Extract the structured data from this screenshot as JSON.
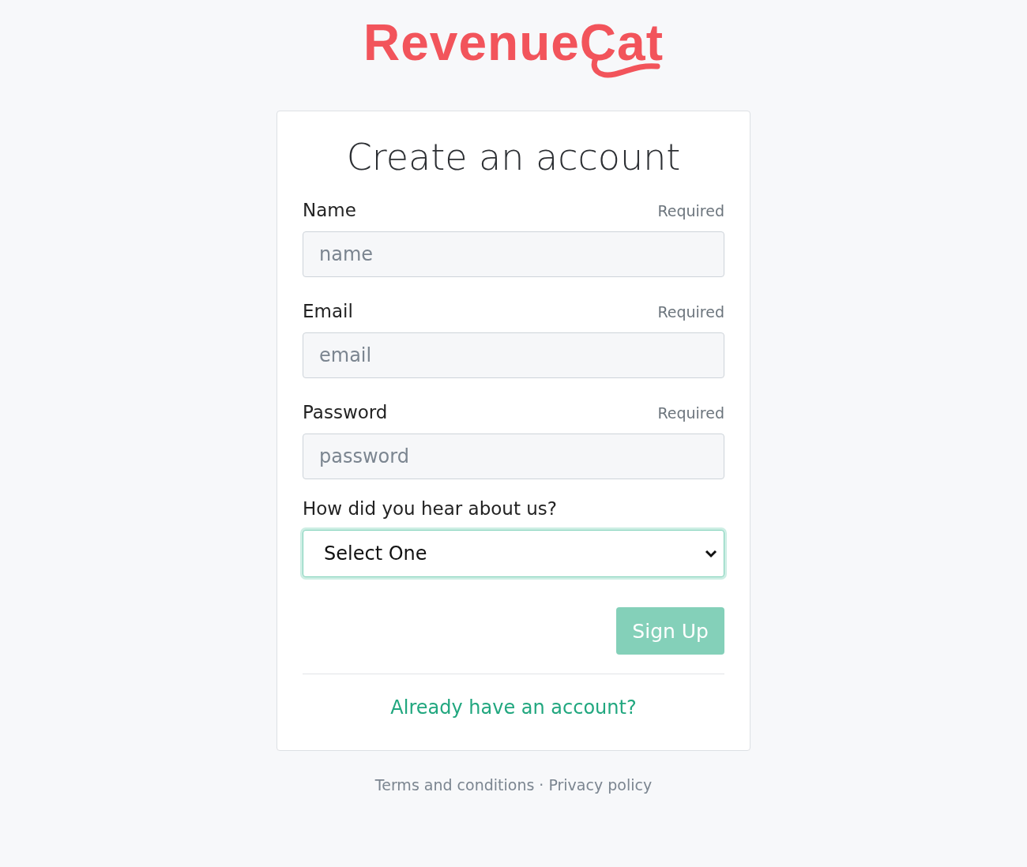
{
  "logo": {
    "text": "RevenueCat"
  },
  "card": {
    "title": "Create an account",
    "fields": [
      {
        "label": "Name",
        "hint": "Required",
        "placeholder": "name"
      },
      {
        "label": "Email",
        "hint": "Required",
        "placeholder": "email"
      },
      {
        "label": "Password",
        "hint": "Required",
        "placeholder": "password"
      }
    ],
    "select": {
      "label": "How did you hear about us?",
      "value": "Select One",
      "focused": true
    },
    "submit": {
      "label": "Sign Up",
      "disabled": true
    },
    "login_link": "Already have an account?"
  },
  "footer": {
    "links": [
      "Terms and conditions",
      "Privacy policy"
    ],
    "separator": "·"
  }
}
